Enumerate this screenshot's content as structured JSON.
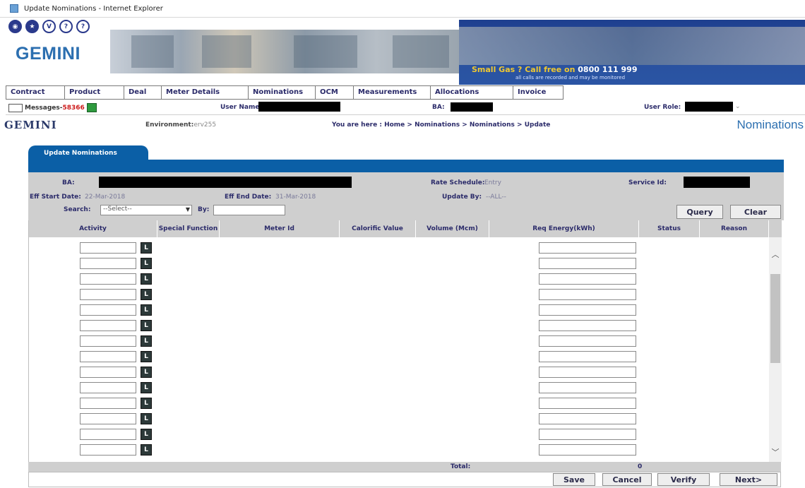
{
  "window": {
    "title": "Update Nominations - Internet Explorer"
  },
  "banner": {
    "logo": "GEMINI",
    "circle_icons": [
      "◉",
      "★",
      "V",
      "?",
      "?"
    ],
    "promo_prefix": "Small Gas ? Call free on",
    "promo_number": "0800 111 999",
    "promo_fine": "all calls are recorded and may be monitored"
  },
  "menu": [
    "Contract",
    "Product",
    "Deal",
    "Meter Details",
    "Nominations",
    "OCM",
    "Measurements",
    "Allocations",
    "Invoice"
  ],
  "info": {
    "messages_label": "Messages-",
    "messages_count": "58366",
    "user_name_label": "User Name:",
    "ba_label": "BA:",
    "user_role_label": "User Role:"
  },
  "path": {
    "title": "GEMINI",
    "environment_label": "Environment:",
    "environment_value": "erv255",
    "breadcrumb": "You are here : Home > Nominations > Nominations > Update",
    "section": "Nominations"
  },
  "tab": {
    "label": "Update Nominations"
  },
  "form": {
    "ba_label": "BA:",
    "rate_schedule_label": "Rate Schedule:",
    "rate_schedule_value": "Entry",
    "service_id_label": "Service Id:",
    "eff_start_label": "Eff Start Date:",
    "eff_start_value": "22-Mar-2018",
    "eff_end_label": "Eff End Date:",
    "eff_end_value": "31-Mar-2018",
    "update_by_label": "Update By:",
    "update_by_value": "--ALL--",
    "search_label": "Search:",
    "search_value": "--Select--",
    "by_label": "By:",
    "query_button": "Query",
    "clear_button": "Clear"
  },
  "grid": {
    "columns": [
      "Activity",
      "Special Function",
      "Meter Id",
      "Calorific Value",
      "Volume (Mcm)",
      "Req Energy(kWh)",
      "Status",
      "Reason"
    ],
    "row_button": "L",
    "row_count": 14
  },
  "total": {
    "label": "Total:",
    "value": "0"
  },
  "buttons": {
    "save": "Save",
    "cancel": "Cancel",
    "verify": "Verify",
    "next": "Next>"
  }
}
